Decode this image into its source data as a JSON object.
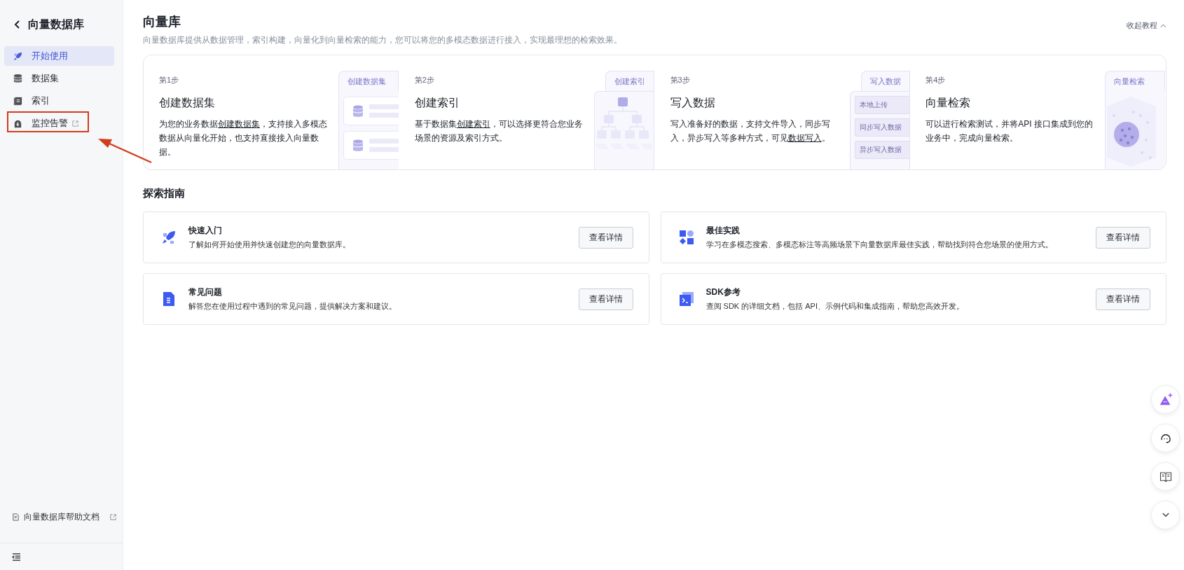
{
  "sidebar": {
    "title": "向量数据库",
    "items": [
      {
        "label": "开始使用",
        "selected": true,
        "external": false,
        "highlighted": false
      },
      {
        "label": "数据集",
        "selected": false,
        "external": false,
        "highlighted": false
      },
      {
        "label": "索引",
        "selected": false,
        "external": false,
        "highlighted": false
      },
      {
        "label": "监控告警",
        "selected": false,
        "external": true,
        "highlighted": true
      }
    ],
    "help_link": "向量数据库帮助文档"
  },
  "header": {
    "title": "向量库",
    "subtitle": "向量数据库提供从数据管理，索引构建，向量化到向量检索的能力，您可以将您的多模态数据进行接入，实现最理想的检索效果。",
    "collapse_link": "收起教程"
  },
  "steps": [
    {
      "kind": "dataset",
      "step": "第1步",
      "title": "创建数据集",
      "desc": [
        {
          "text": "为您的业务数据",
          "link": false
        },
        {
          "text": "创建数据集",
          "link": true
        },
        {
          "text": "，支持接入多模态数据从向量化开始，也支持直接接入向量数据。",
          "link": false
        }
      ],
      "panel_tab": "创建数据集"
    },
    {
      "kind": "index",
      "step": "第2步",
      "title": "创建索引",
      "desc": [
        {
          "text": "基于数据集",
          "link": false
        },
        {
          "text": "创建索引",
          "link": true
        },
        {
          "text": "，可以选择更符合您业务场景的资源及索引方式。",
          "link": false
        }
      ],
      "panel_tab": "创建索引"
    },
    {
      "kind": "write",
      "step": "第3步",
      "title": "写入数据",
      "desc": [
        {
          "text": "写入准备好的数据，支持文件导入，同步写入，异步写入等多种方式，可见",
          "link": false
        },
        {
          "text": "数据写入",
          "link": true
        },
        {
          "text": "。",
          "link": false
        }
      ],
      "panel_tab": "写入数据",
      "panel_items": [
        "本地上传",
        "同步写入数据",
        "异步写入数据"
      ]
    },
    {
      "kind": "search",
      "step": "第4步",
      "title": "向量检索",
      "desc": [
        {
          "text": "可以进行检索测试，并将API 接口集成到您的业务中，完成向量检索。",
          "link": false
        }
      ],
      "panel_tab": "向量检索"
    }
  ],
  "explore": {
    "heading": "探索指南",
    "cards": [
      {
        "kind": "rocket",
        "title": "快速入门",
        "desc": "了解如何开始使用并快速创建您的向量数据库。",
        "button": "查看详情"
      },
      {
        "kind": "shapes",
        "title": "最佳实践",
        "desc": "学习在多模态搜索、多模态标注等高频场景下向量数据库最佳实践，帮助找到符合您场景的使用方式。",
        "button": "查看详情"
      },
      {
        "kind": "doc",
        "title": "常见问题",
        "desc": "解答您在使用过程中遇到的常见问题，提供解决方案和建议。",
        "button": "查看详情"
      },
      {
        "kind": "terminal",
        "title": "SDK参考",
        "desc": "查阅 SDK 的详细文档，包括 API、示例代码和集成指南，帮助您高效开发。",
        "button": "查看详情"
      }
    ]
  }
}
